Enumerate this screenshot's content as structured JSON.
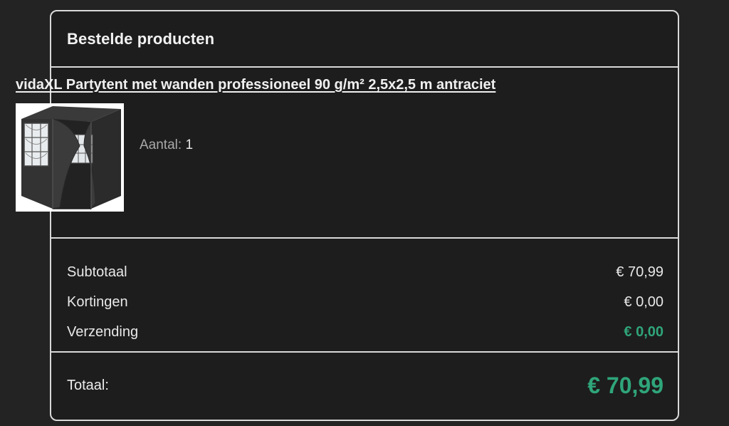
{
  "section": {
    "title": "Bestelde producten"
  },
  "product": {
    "name": "vidaXL Partytent met wanden professioneel 90 g/m² 2,5x2,5 m antraciet",
    "image_icon": "tent-product-image",
    "quantity_label": "Aantal:",
    "quantity_value": "1"
  },
  "totals": {
    "subtotal_label": "Subtotaal",
    "subtotal_value": "€ 70,99",
    "discount_label": "Kortingen",
    "discount_value": "€ 0,00",
    "shipping_label": "Verzending",
    "shipping_value": "€ 0,00"
  },
  "grand_total": {
    "label": "Totaal:",
    "value": "€ 70,99"
  },
  "colors": {
    "accent_green": "#2fa57a",
    "background": "#1d1d1d",
    "border": "#d9d9d9"
  }
}
